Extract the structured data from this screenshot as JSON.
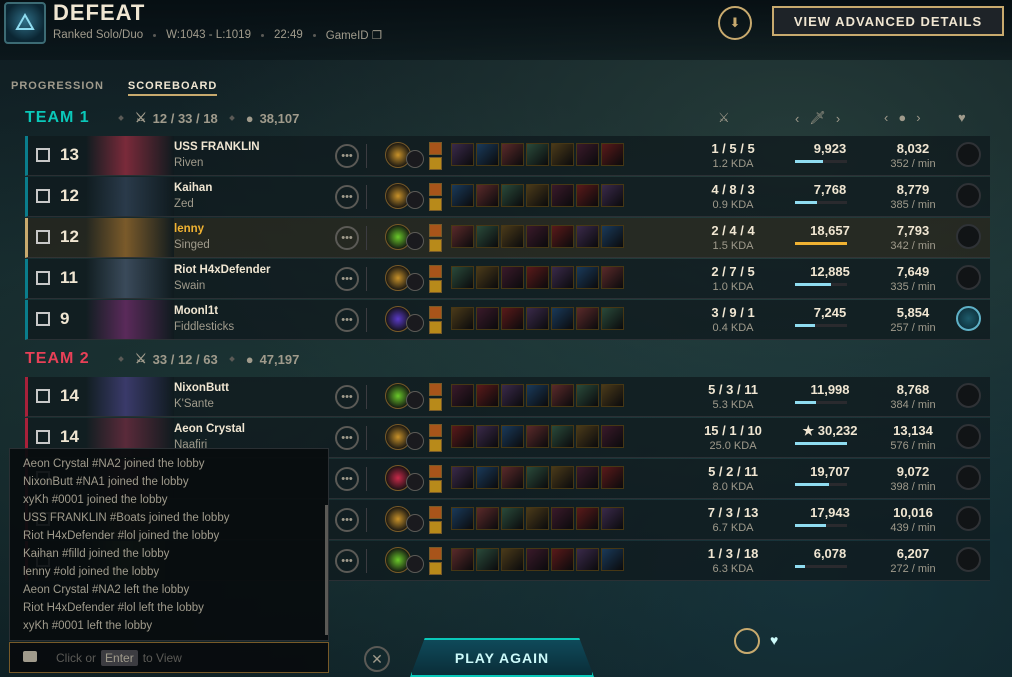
{
  "header": {
    "result": "DEFEAT",
    "queue": "Ranked Solo/Duo",
    "record": "W:1043 - L:1019",
    "duration": "22:49",
    "game_id_label": "GameID",
    "advanced_button": "VIEW ADVANCED DETAILS"
  },
  "tabs": [
    "PROGRESSION",
    "SCOREBOARD"
  ],
  "teams": [
    {
      "name": "TEAM 1",
      "kda": "12 / 33 / 18",
      "gold": "38,107",
      "players": [
        {
          "level": "13",
          "name": "USS FRANKLIN",
          "champion": "Riven",
          "kda": "1 / 5 / 5",
          "kda_ratio": "1.2 KDA",
          "damage": "9,923",
          "damage_fraction": 0.53,
          "gold": "8,032",
          "gold_per_min": "352 / min",
          "honor_given": false,
          "you": false
        },
        {
          "level": "12",
          "name": "Kaihan",
          "champion": "Zed",
          "kda": "4 / 8 / 3",
          "kda_ratio": "0.9 KDA",
          "damage": "7,768",
          "damage_fraction": 0.42,
          "gold": "8,779",
          "gold_per_min": "385 / min",
          "honor_given": false,
          "you": false
        },
        {
          "level": "12",
          "name": "lenny",
          "champion": "Singed",
          "kda": "2 / 4 / 4",
          "kda_ratio": "1.5 KDA",
          "damage": "18,657",
          "damage_fraction": 1.0,
          "gold": "7,793",
          "gold_per_min": "342 / min",
          "honor_given": false,
          "you": true
        },
        {
          "level": "11",
          "name": "Riot H4xDefender",
          "champion": "Swain",
          "kda": "2 / 7 / 5",
          "kda_ratio": "1.0 KDA",
          "damage": "12,885",
          "damage_fraction": 0.69,
          "gold": "7,649",
          "gold_per_min": "335 / min",
          "honor_given": false,
          "you": false
        },
        {
          "level": "9",
          "name": "Moonl1t",
          "champion": "Fiddlesticks",
          "kda": "3 / 9 / 1",
          "kda_ratio": "0.4 KDA",
          "damage": "7,245",
          "damage_fraction": 0.39,
          "gold": "5,854",
          "gold_per_min": "257 / min",
          "honor_given": true,
          "you": false
        }
      ]
    },
    {
      "name": "TEAM 2",
      "kda": "33 / 12 / 63",
      "gold": "47,197",
      "players": [
        {
          "level": "14",
          "name": "NixonButt",
          "champion": "K'Sante",
          "kda": "5 / 3 / 11",
          "kda_ratio": "5.3 KDA",
          "damage": "11,998",
          "damage_fraction": 0.4,
          "gold": "8,768",
          "gold_per_min": "384 / min",
          "honor_given": false,
          "you": false
        },
        {
          "level": "14",
          "name": "Aeon Crystal",
          "champion": "Naafiri",
          "kda": "15 / 1 / 10",
          "kda_ratio": "25.0 KDA",
          "damage": "★ 30,232",
          "damage_fraction": 1.0,
          "gold": "13,134",
          "gold_per_min": "576 / min",
          "honor_given": false,
          "you": false
        },
        {
          "level": "",
          "name": "",
          "champion": "",
          "kda": "5 / 2 / 11",
          "kda_ratio": "8.0 KDA",
          "damage": "19,707",
          "damage_fraction": 0.65,
          "gold": "9,072",
          "gold_per_min": "398 / min",
          "honor_given": false,
          "you": false
        },
        {
          "level": "",
          "name": "",
          "champion": "",
          "kda": "7 / 3 / 13",
          "kda_ratio": "6.7 KDA",
          "damage": "17,943",
          "damage_fraction": 0.59,
          "gold": "10,016",
          "gold_per_min": "439 / min",
          "honor_given": false,
          "you": false
        },
        {
          "level": "",
          "name": "",
          "champion": "",
          "kda": "1 / 3 / 18",
          "kda_ratio": "6.3 KDA",
          "damage": "6,078",
          "damage_fraction": 0.2,
          "gold": "6,207",
          "gold_per_min": "272 / min",
          "honor_given": false,
          "you": false
        }
      ]
    }
  ],
  "chat": {
    "messages": [
      "Aeon Crystal #NA2 joined the lobby",
      "NixonButt #NA1 joined the lobby",
      "xyKh #0001 joined the lobby",
      "USS FRANKLIN #Boats joined the lobby",
      "Riot H4xDefender #lol joined the lobby",
      "Kaihan #filld joined the lobby",
      "lenny #old joined the lobby",
      "Aeon Crystal #NA2 left the lobby",
      "Riot H4xDefender #lol left the lobby",
      "xyKh #0001 left the lobby"
    ],
    "placeholder_pre": "Click or",
    "placeholder_key": "Enter",
    "placeholder_post": "to View"
  },
  "play_again": "PLAY AGAIN",
  "colors": {
    "gold": "#c8aa6e",
    "team1": "#0ac8b9",
    "team2": "#e84057",
    "you": "#f0b232"
  }
}
